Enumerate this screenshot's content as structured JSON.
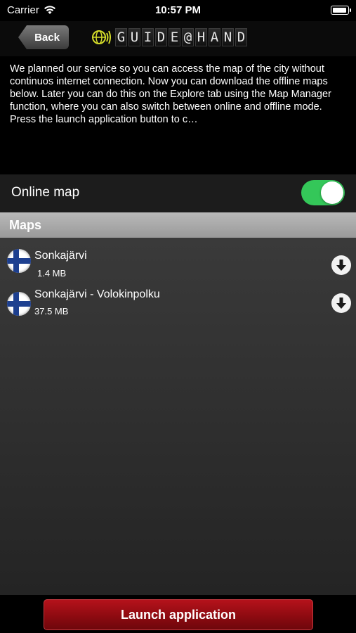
{
  "status_bar": {
    "carrier": "Carrier",
    "time": "10:57 PM",
    "battery_level": 0.95
  },
  "nav": {
    "back_label": "Back",
    "logo_letters": [
      "G",
      "U",
      "I",
      "D",
      "E",
      "@",
      "H",
      "A",
      "N",
      "D"
    ]
  },
  "intro": {
    "text": "We planned our service so you can access the map of the city without continuos internet connection. Now you can download the offline maps below. Later you can do this on the Explore tab using the Map Manager function, where you can also switch between online and offline mode. Press the launch application button to c…"
  },
  "online_map": {
    "label": "Online map",
    "enabled": true
  },
  "maps_section": {
    "title": "Maps"
  },
  "maps": [
    {
      "name": "Sonkajärvi",
      "size": "1.4 MB"
    },
    {
      "name": "Sonkajärvi - Volokinpolku",
      "size": "37.5 MB"
    }
  ],
  "colors": {
    "toggle_on": "#34c759",
    "launch_button": "#b5121b",
    "flag_blue": "#1d3f8f"
  },
  "footer": {
    "launch_label": "Launch application"
  }
}
